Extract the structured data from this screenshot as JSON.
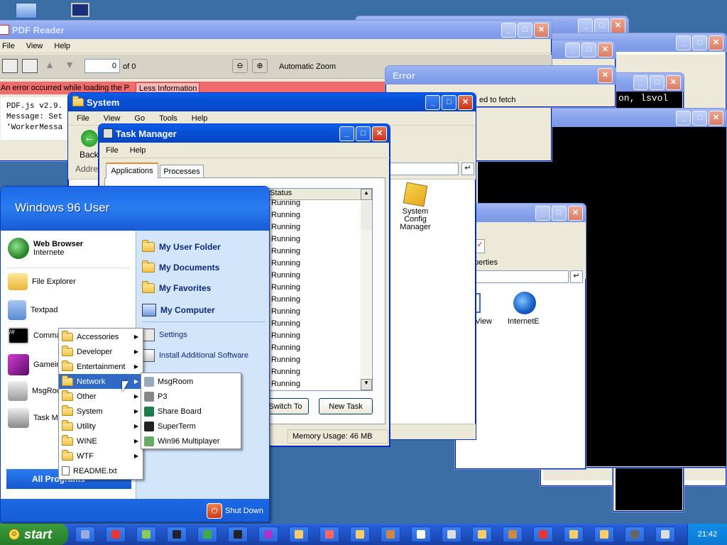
{
  "desktop": {
    "background_color": "#3a6ea5"
  },
  "pdf_reader": {
    "title": "PDF Reader",
    "menu": [
      "File",
      "View",
      "Help"
    ],
    "page_input": "0",
    "page_of": "of 0",
    "zoom": "Automatic Zoom",
    "error_banner": "An error occurred while loading the PDF.",
    "less_info_button": "Less Information",
    "error_details": [
      "PDF.js v2.9.",
      "Message: Set",
      "'WorkerMessa"
    ]
  },
  "error_window": {
    "title": "Error",
    "message": "ed to fetch"
  },
  "terminal_window": {
    "text_line1": "on, lsvol"
  },
  "system_window": {
    "title": "System",
    "menu": [
      "File",
      "View",
      "Go",
      "Tools",
      "Help"
    ],
    "back_label": "Back",
    "address_label": "Address",
    "icons": [
      {
        "label": "System Config Manager",
        "icon": "config-manager-icon"
      }
    ]
  },
  "explorer_window2": {
    "properties_label": "Properties",
    "icons": [
      {
        "label": "View",
        "icon": "view-icon"
      },
      {
        "label": "InternetE",
        "icon": "internet-explorer-icon"
      }
    ]
  },
  "task_manager": {
    "title": "Task Manager",
    "menu": [
      "File",
      "Help"
    ],
    "tabs": [
      "Applications",
      "Processes"
    ],
    "column_status": "Status",
    "statuses": [
      "Running",
      "Running",
      "Running",
      "Running",
      "Running",
      "Running",
      "Running",
      "Running",
      "Running",
      "Running",
      "Running",
      "Running",
      "Running",
      "Running",
      "Running",
      "Running"
    ],
    "switch_to": "Switch To",
    "new_task": "New Task",
    "memory": "Memory Usage: 46 MB"
  },
  "start_menu": {
    "user": "Windows 96 User",
    "left_items": [
      {
        "label": "Web Browser",
        "sub": "Internete",
        "icon": "web-browser-icon"
      },
      {
        "label": "File Explorer",
        "icon": "file-explorer-icon"
      },
      {
        "label": "Textpad",
        "icon": "textpad-icon"
      },
      {
        "label": "Comman",
        "icon": "command-prompt-icon"
      },
      {
        "label": "Gamein",
        "icon": "gameing-icon"
      },
      {
        "label": "MsgRoo",
        "icon": "msgroom-icon"
      },
      {
        "label": "Task Ma",
        "icon": "task-manager-icon"
      }
    ],
    "right_items": [
      "My User Folder",
      "My Documents",
      "My Favorites",
      "My Computer"
    ],
    "right_items2": [
      "Settings",
      "Install Additional Software"
    ],
    "all_programs": "All Programs",
    "shutdown": "Shut Down"
  },
  "programs_menu": {
    "items": [
      "Accessories",
      "Developer",
      "Entertainment",
      "Network",
      "Other",
      "System",
      "Utility",
      "WINE",
      "WTF",
      "README.txt"
    ],
    "highlighted": "Network"
  },
  "network_menu": {
    "items": [
      "MsgRoom",
      "P3",
      "Share Board",
      "SuperTerm",
      "Win96 Multiplayer"
    ]
  },
  "taskbar": {
    "start_label": "start",
    "clock": "21:42",
    "button_colors": [
      "#9ad",
      "#e33",
      "#8c5",
      "#223",
      "#4a4",
      "#222",
      "#a3c",
      "#fc6",
      "#f66",
      "#fc6",
      "#c84",
      "#fff",
      "#ddd",
      "#fc6",
      "#c84",
      "#e33",
      "#fc6",
      "#fc6",
      "#666",
      "#ddd"
    ]
  }
}
